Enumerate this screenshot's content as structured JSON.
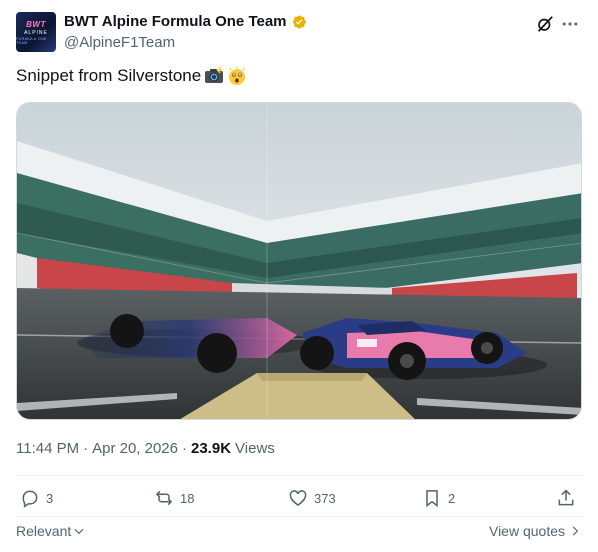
{
  "author": {
    "display_name": "BWT Alpine Formula One Team",
    "handle": "@AlpineF1Team",
    "avatar_text": [
      "BWT",
      "ALPINE",
      "FORMULA ONE TEAM"
    ],
    "verified": true,
    "verified_color": "#e8b200"
  },
  "tweet": {
    "text": "Snippet from Silverstone",
    "emojis": [
      "camera-with-flash-emoji",
      "astonished-face-emoji"
    ]
  },
  "media": {
    "icon": "race-car-photo"
  },
  "meta": {
    "time": "11:44 PM",
    "separator": "·",
    "date": "Apr 20, 2026",
    "views_count": "23.9K",
    "views_label": "Views"
  },
  "actions": {
    "replies": "3",
    "reposts": "18",
    "likes": "373",
    "bookmarks": "2"
  },
  "footer": {
    "sort_label": "Relevant",
    "view_quotes_label": "View quotes"
  },
  "colors": {
    "text_primary": "#0f1419",
    "text_secondary": "#536471",
    "divider": "#eff3f4"
  }
}
